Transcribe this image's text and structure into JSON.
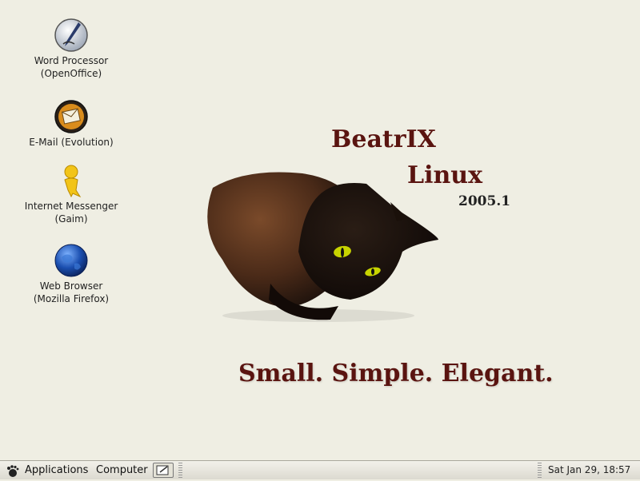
{
  "desktop": {
    "icons": [
      {
        "name": "word-processor",
        "line1": "Word Processor",
        "line2": "(OpenOffice)",
        "icon": "quill-pen-icon"
      },
      {
        "name": "email",
        "line1": "E-Mail (Evolution)",
        "line2": "",
        "icon": "envelope-icon"
      },
      {
        "name": "messenger",
        "line1": "Internet Messenger",
        "line2": "(Gaim)",
        "icon": "person-icon"
      },
      {
        "name": "web-browser",
        "line1": "Web Browser",
        "line2": "(Mozilla Firefox)",
        "icon": "globe-icon"
      }
    ],
    "wallpaper": {
      "title": "BeatrIX",
      "subtitle": "Linux",
      "version": "2005.1",
      "slogan": "Small. Simple. Elegant."
    }
  },
  "panel": {
    "applications_label": "Applications",
    "computer_label": "Computer",
    "clock": "Sat Jan 29, 18:57"
  },
  "colors": {
    "desktop_bg": "#efeee3",
    "brand_text": "#5a1410",
    "panel_bg": "#e6e4da"
  }
}
